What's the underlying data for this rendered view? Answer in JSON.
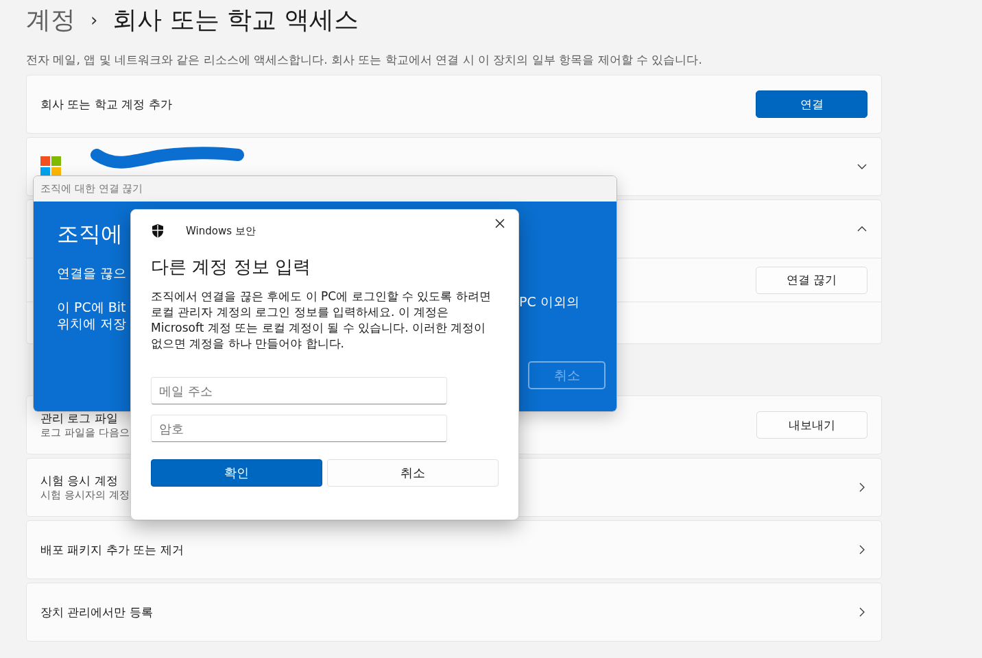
{
  "breadcrumb": {
    "parent": "계정",
    "separator": "›",
    "current": "회사 또는 학교 액세스"
  },
  "description": "전자 메일, 앱 및 네트워크와 같은 리소스에 액세스합니다. 회사 또는 학교에서 연결 시 이 장치의 일부 항목을 제어할 수 있습니다.",
  "add_account": {
    "label": "회사 또는 학교 계정 추가",
    "button": "연결"
  },
  "account": {
    "expanded": false
  },
  "account_2": {
    "expanded": true,
    "button": "연결 끊기"
  },
  "settings_rows": [
    {
      "kind": "button",
      "title": "관리 로그 파일",
      "subtitle": "로그 파일을 다음으",
      "button": "내보내기"
    },
    {
      "kind": "link",
      "title": "시험 응시 계정",
      "subtitle": "시험 응시자의 계정"
    },
    {
      "kind": "link",
      "title": "배포 패키지 추가 또는 제거"
    },
    {
      "kind": "link",
      "title": "장치 관리에서만 등록"
    }
  ],
  "disconnect_dialog": {
    "title": "조직에 대한 연결 끊기",
    "heading": "조직에",
    "intro": "연결을 끊으",
    "lines": [
      "이 PC에 Bit",
      "위치에 저장"
    ],
    "right_text": "PC 이외의",
    "cancel_button": {
      "label": "취소",
      "disabled": true
    }
  },
  "security_dialog": {
    "app": "Windows 보안",
    "heading": "다른 계정 정보 입력",
    "body": "조직에서 연결을 끊은 후에도 이 PC에 로그인할 수 있도록 하려면 로컬 관리자 계정의 로그인 정보를 입력하세요. 이 계정은 Microsoft 계정 또는 로컬 계정이 될 수 있습니다. 이러한 계정이 없으면 계정을 하나 만들어야 합니다.",
    "fields": [
      {
        "placeholder": "메일 주소"
      },
      {
        "placeholder": "암호"
      }
    ],
    "buttons": [
      {
        "label": "확인",
        "primary": true
      },
      {
        "label": "취소",
        "primary": false
      }
    ]
  }
}
